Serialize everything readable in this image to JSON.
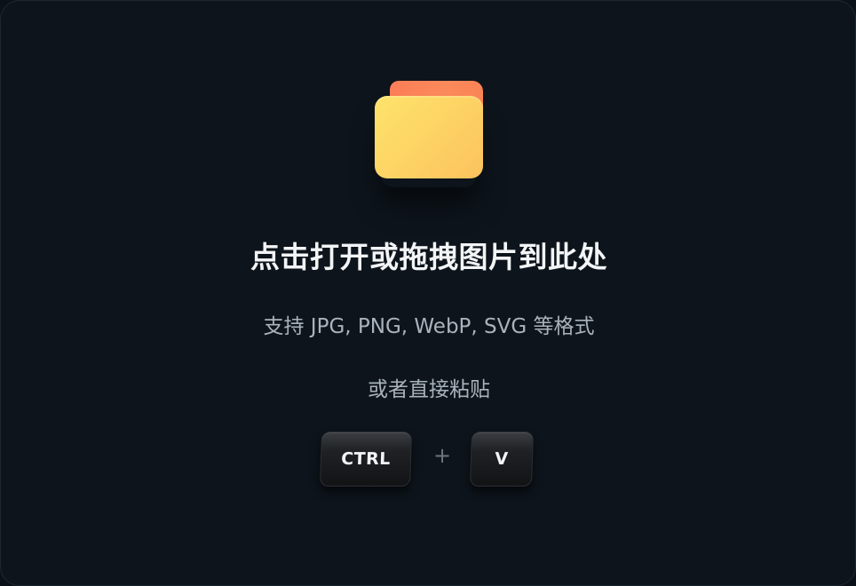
{
  "dropzone": {
    "icon": "folder-icon",
    "title": "点击打开或拖拽图片到此处",
    "formats": "支持 JPG, PNG, WebP, SVG 等格式",
    "paste_hint": "或者直接粘贴",
    "shortcut": {
      "key1": "CTRL",
      "separator": "+",
      "key2": "V"
    }
  },
  "colors": {
    "background": "#0d141b",
    "folder_front": "#fdd565",
    "folder_tab": "#fb7d57",
    "title_text": "#f2f4f6",
    "secondary_text": "#a9b3bd"
  }
}
